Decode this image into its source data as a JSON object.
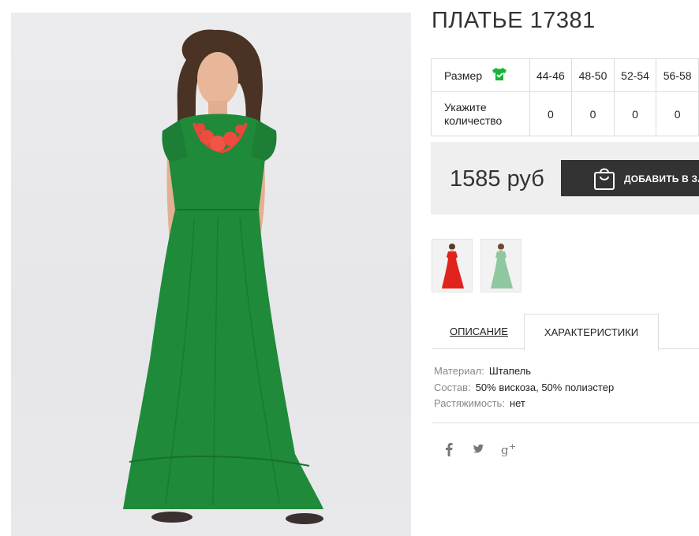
{
  "product": {
    "title": "ПЛАТЬЕ 17381",
    "price": "1585 руб",
    "add_to_cart_label": "ДОБАВИТЬ В ЗА"
  },
  "size_table": {
    "size_header": "Размер",
    "qty_header_line1": "Укажите",
    "qty_header_line2": "количество",
    "sizes": [
      "44-46",
      "48-50",
      "52-54",
      "56-58"
    ],
    "quantities": [
      "0",
      "0",
      "0",
      "0"
    ]
  },
  "thumbnails": [
    {
      "color": "#e0231d"
    },
    {
      "color": "#8fc7a0"
    }
  ],
  "tabs": {
    "description": "ОПИСАНИЕ",
    "characteristics": "ХАРАКТЕРИСТИКИ",
    "active": "characteristics"
  },
  "characteristics": [
    {
      "key": "Материал:",
      "value": "Штапель"
    },
    {
      "key": "Состав:",
      "value": "50% вискоза, 50% полиэстер"
    },
    {
      "key": "Растяжимость:",
      "value": "нет"
    }
  ],
  "social": [
    "facebook-icon",
    "twitter-icon",
    "google-plus-icon"
  ],
  "colors": {
    "dress_green": "#1f8a3a",
    "button_dark": "#333333",
    "price_bg": "#efefef",
    "size_icon": "#17b33a"
  }
}
